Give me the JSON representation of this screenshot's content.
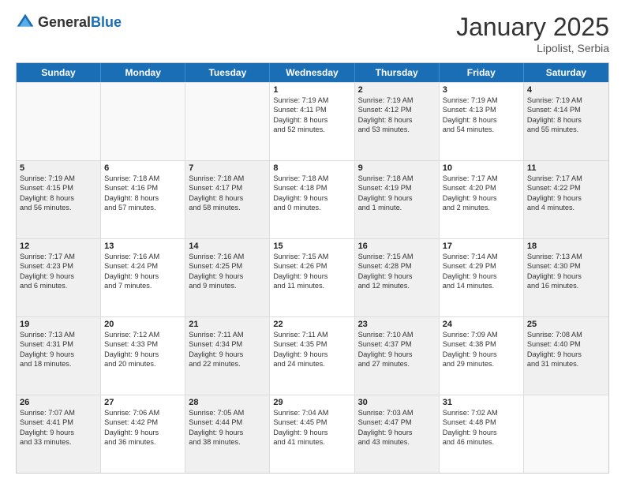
{
  "logo": {
    "general": "General",
    "blue": "Blue"
  },
  "header": {
    "title": "January 2025",
    "subtitle": "Lipolist, Serbia"
  },
  "weekdays": [
    "Sunday",
    "Monday",
    "Tuesday",
    "Wednesday",
    "Thursday",
    "Friday",
    "Saturday"
  ],
  "weeks": [
    [
      {
        "day": "",
        "empty": true,
        "shaded": false,
        "lines": []
      },
      {
        "day": "",
        "empty": true,
        "shaded": false,
        "lines": []
      },
      {
        "day": "",
        "empty": true,
        "shaded": false,
        "lines": []
      },
      {
        "day": "1",
        "empty": false,
        "shaded": false,
        "lines": [
          "Sunrise: 7:19 AM",
          "Sunset: 4:11 PM",
          "Daylight: 8 hours",
          "and 52 minutes."
        ]
      },
      {
        "day": "2",
        "empty": false,
        "shaded": true,
        "lines": [
          "Sunrise: 7:19 AM",
          "Sunset: 4:12 PM",
          "Daylight: 8 hours",
          "and 53 minutes."
        ]
      },
      {
        "day": "3",
        "empty": false,
        "shaded": false,
        "lines": [
          "Sunrise: 7:19 AM",
          "Sunset: 4:13 PM",
          "Daylight: 8 hours",
          "and 54 minutes."
        ]
      },
      {
        "day": "4",
        "empty": false,
        "shaded": true,
        "lines": [
          "Sunrise: 7:19 AM",
          "Sunset: 4:14 PM",
          "Daylight: 8 hours",
          "and 55 minutes."
        ]
      }
    ],
    [
      {
        "day": "5",
        "empty": false,
        "shaded": true,
        "lines": [
          "Sunrise: 7:19 AM",
          "Sunset: 4:15 PM",
          "Daylight: 8 hours",
          "and 56 minutes."
        ]
      },
      {
        "day": "6",
        "empty": false,
        "shaded": false,
        "lines": [
          "Sunrise: 7:18 AM",
          "Sunset: 4:16 PM",
          "Daylight: 8 hours",
          "and 57 minutes."
        ]
      },
      {
        "day": "7",
        "empty": false,
        "shaded": true,
        "lines": [
          "Sunrise: 7:18 AM",
          "Sunset: 4:17 PM",
          "Daylight: 8 hours",
          "and 58 minutes."
        ]
      },
      {
        "day": "8",
        "empty": false,
        "shaded": false,
        "lines": [
          "Sunrise: 7:18 AM",
          "Sunset: 4:18 PM",
          "Daylight: 9 hours",
          "and 0 minutes."
        ]
      },
      {
        "day": "9",
        "empty": false,
        "shaded": true,
        "lines": [
          "Sunrise: 7:18 AM",
          "Sunset: 4:19 PM",
          "Daylight: 9 hours",
          "and 1 minute."
        ]
      },
      {
        "day": "10",
        "empty": false,
        "shaded": false,
        "lines": [
          "Sunrise: 7:17 AM",
          "Sunset: 4:20 PM",
          "Daylight: 9 hours",
          "and 2 minutes."
        ]
      },
      {
        "day": "11",
        "empty": false,
        "shaded": true,
        "lines": [
          "Sunrise: 7:17 AM",
          "Sunset: 4:22 PM",
          "Daylight: 9 hours",
          "and 4 minutes."
        ]
      }
    ],
    [
      {
        "day": "12",
        "empty": false,
        "shaded": true,
        "lines": [
          "Sunrise: 7:17 AM",
          "Sunset: 4:23 PM",
          "Daylight: 9 hours",
          "and 6 minutes."
        ]
      },
      {
        "day": "13",
        "empty": false,
        "shaded": false,
        "lines": [
          "Sunrise: 7:16 AM",
          "Sunset: 4:24 PM",
          "Daylight: 9 hours",
          "and 7 minutes."
        ]
      },
      {
        "day": "14",
        "empty": false,
        "shaded": true,
        "lines": [
          "Sunrise: 7:16 AM",
          "Sunset: 4:25 PM",
          "Daylight: 9 hours",
          "and 9 minutes."
        ]
      },
      {
        "day": "15",
        "empty": false,
        "shaded": false,
        "lines": [
          "Sunrise: 7:15 AM",
          "Sunset: 4:26 PM",
          "Daylight: 9 hours",
          "and 11 minutes."
        ]
      },
      {
        "day": "16",
        "empty": false,
        "shaded": true,
        "lines": [
          "Sunrise: 7:15 AM",
          "Sunset: 4:28 PM",
          "Daylight: 9 hours",
          "and 12 minutes."
        ]
      },
      {
        "day": "17",
        "empty": false,
        "shaded": false,
        "lines": [
          "Sunrise: 7:14 AM",
          "Sunset: 4:29 PM",
          "Daylight: 9 hours",
          "and 14 minutes."
        ]
      },
      {
        "day": "18",
        "empty": false,
        "shaded": true,
        "lines": [
          "Sunrise: 7:13 AM",
          "Sunset: 4:30 PM",
          "Daylight: 9 hours",
          "and 16 minutes."
        ]
      }
    ],
    [
      {
        "day": "19",
        "empty": false,
        "shaded": true,
        "lines": [
          "Sunrise: 7:13 AM",
          "Sunset: 4:31 PM",
          "Daylight: 9 hours",
          "and 18 minutes."
        ]
      },
      {
        "day": "20",
        "empty": false,
        "shaded": false,
        "lines": [
          "Sunrise: 7:12 AM",
          "Sunset: 4:33 PM",
          "Daylight: 9 hours",
          "and 20 minutes."
        ]
      },
      {
        "day": "21",
        "empty": false,
        "shaded": true,
        "lines": [
          "Sunrise: 7:11 AM",
          "Sunset: 4:34 PM",
          "Daylight: 9 hours",
          "and 22 minutes."
        ]
      },
      {
        "day": "22",
        "empty": false,
        "shaded": false,
        "lines": [
          "Sunrise: 7:11 AM",
          "Sunset: 4:35 PM",
          "Daylight: 9 hours",
          "and 24 minutes."
        ]
      },
      {
        "day": "23",
        "empty": false,
        "shaded": true,
        "lines": [
          "Sunrise: 7:10 AM",
          "Sunset: 4:37 PM",
          "Daylight: 9 hours",
          "and 27 minutes."
        ]
      },
      {
        "day": "24",
        "empty": false,
        "shaded": false,
        "lines": [
          "Sunrise: 7:09 AM",
          "Sunset: 4:38 PM",
          "Daylight: 9 hours",
          "and 29 minutes."
        ]
      },
      {
        "day": "25",
        "empty": false,
        "shaded": true,
        "lines": [
          "Sunrise: 7:08 AM",
          "Sunset: 4:40 PM",
          "Daylight: 9 hours",
          "and 31 minutes."
        ]
      }
    ],
    [
      {
        "day": "26",
        "empty": false,
        "shaded": true,
        "lines": [
          "Sunrise: 7:07 AM",
          "Sunset: 4:41 PM",
          "Daylight: 9 hours",
          "and 33 minutes."
        ]
      },
      {
        "day": "27",
        "empty": false,
        "shaded": false,
        "lines": [
          "Sunrise: 7:06 AM",
          "Sunset: 4:42 PM",
          "Daylight: 9 hours",
          "and 36 minutes."
        ]
      },
      {
        "day": "28",
        "empty": false,
        "shaded": true,
        "lines": [
          "Sunrise: 7:05 AM",
          "Sunset: 4:44 PM",
          "Daylight: 9 hours",
          "and 38 minutes."
        ]
      },
      {
        "day": "29",
        "empty": false,
        "shaded": false,
        "lines": [
          "Sunrise: 7:04 AM",
          "Sunset: 4:45 PM",
          "Daylight: 9 hours",
          "and 41 minutes."
        ]
      },
      {
        "day": "30",
        "empty": false,
        "shaded": true,
        "lines": [
          "Sunrise: 7:03 AM",
          "Sunset: 4:47 PM",
          "Daylight: 9 hours",
          "and 43 minutes."
        ]
      },
      {
        "day": "31",
        "empty": false,
        "shaded": false,
        "lines": [
          "Sunrise: 7:02 AM",
          "Sunset: 4:48 PM",
          "Daylight: 9 hours",
          "and 46 minutes."
        ]
      },
      {
        "day": "",
        "empty": true,
        "shaded": true,
        "lines": []
      }
    ]
  ]
}
